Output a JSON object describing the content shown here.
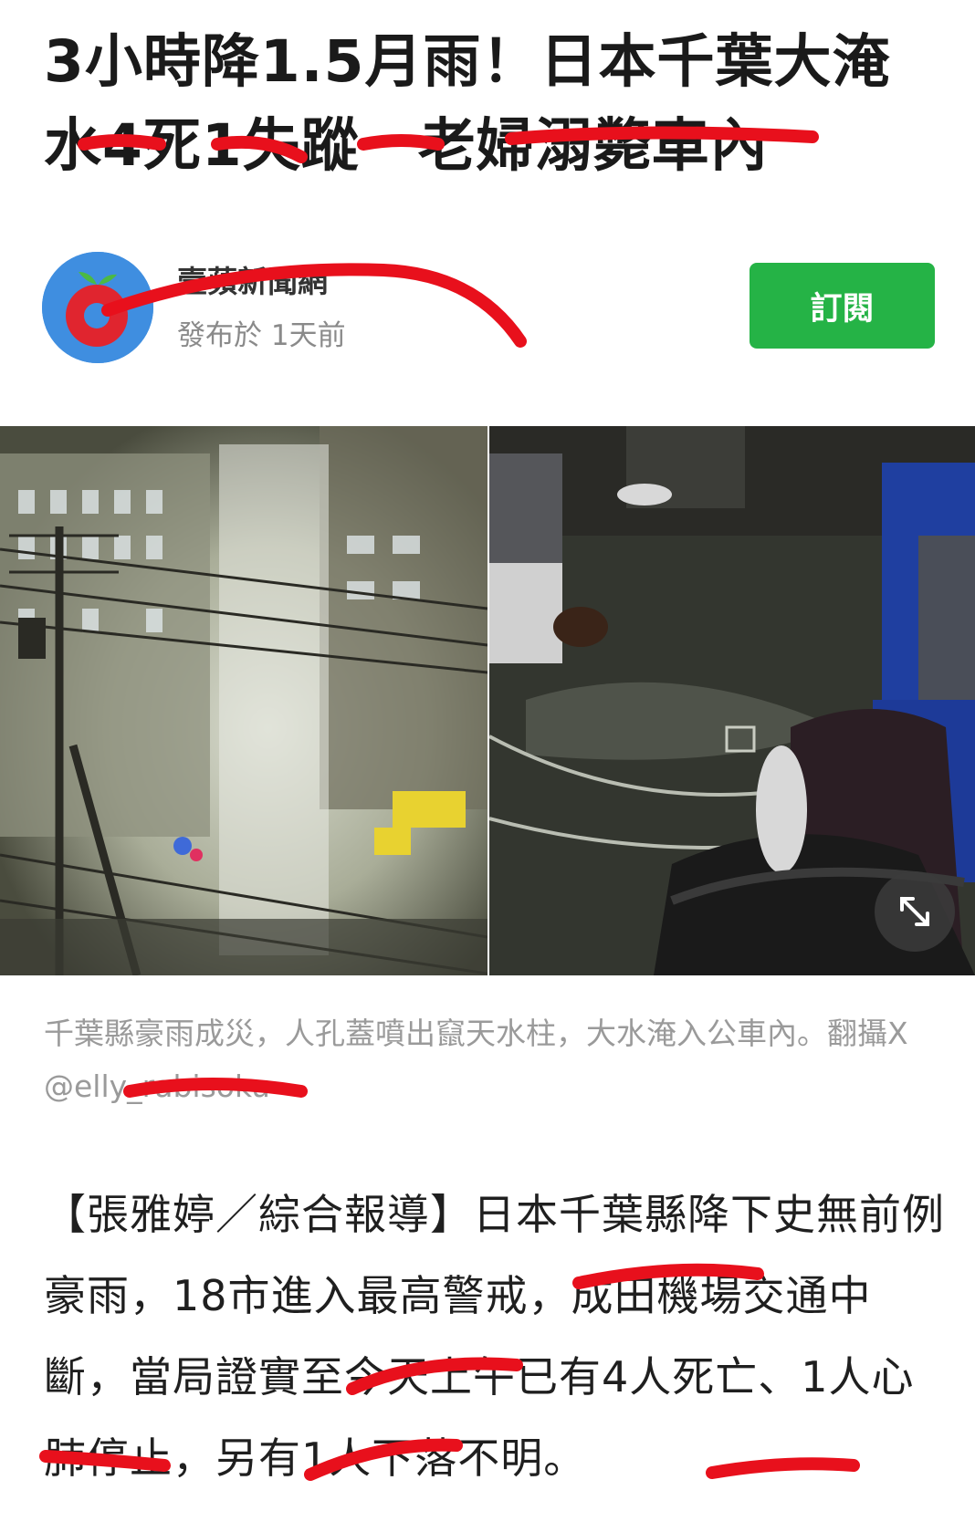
{
  "article": {
    "headline": "3小時降1.5月雨！日本千葉大淹水4死1失蹤　老婦溺斃車內",
    "publisher_name": "壹蘋新聞網",
    "published_time": "發布於 1天前",
    "subscribe_label": "訂閱",
    "photo_caption": "千葉縣豪雨成災，人孔蓋噴出竄天水柱，大水淹入公車內。翻攝X @elly_rabisoku",
    "body": "【張雅婷／綜合報導】日本千葉縣降下史無前例豪雨，18市進入最高警戒，成田機場交通中斷，當局證實至今天上午已有4人死亡、1人心肺停止，另有1人下落不明。"
  },
  "icons": {
    "publisher_logo": "apple-logo-icon",
    "expand": "expand-icon"
  },
  "colors": {
    "subscribe_green": "#25b346",
    "logo_blue": "#3f8ee0",
    "logo_red": "#e0252f",
    "redaction_red": "#e8101c"
  }
}
